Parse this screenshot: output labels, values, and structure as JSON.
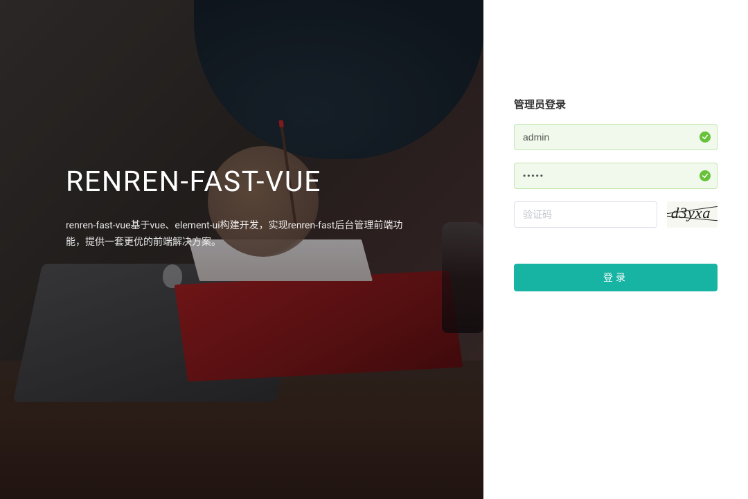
{
  "brand": {
    "title": "RENREN-FAST-VUE",
    "description": "renren-fast-vue基于vue、element-ui构建开发，实现renren-fast后台管理前端功能，提供一套更优的前端解决方案。"
  },
  "login": {
    "title": "管理员登录",
    "username": {
      "value": "admin",
      "validated": true
    },
    "password": {
      "value": "•••••",
      "validated": true
    },
    "captcha": {
      "placeholder": "验证码",
      "value": "",
      "image_text": "d3yxa"
    },
    "submit_label": "登录"
  },
  "colors": {
    "primary": "#17b3a3",
    "success": "#67c23a",
    "input_success_bg": "#f0f9eb",
    "input_success_border": "#c2e7b0"
  }
}
